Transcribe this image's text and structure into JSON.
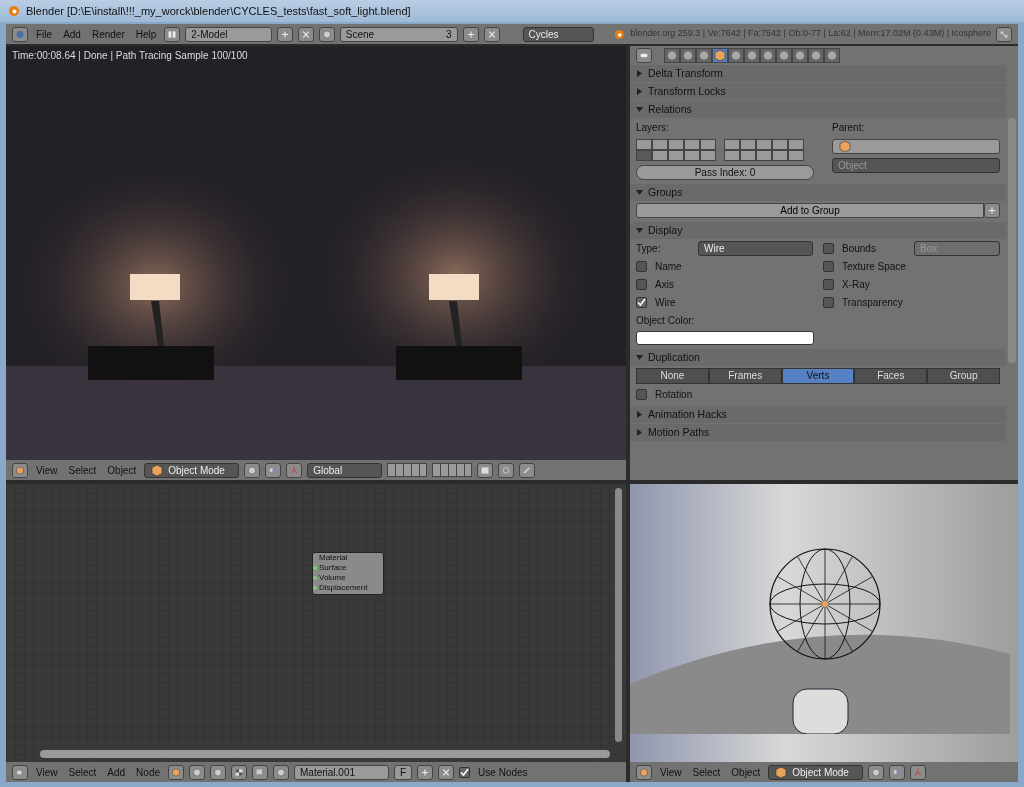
{
  "window": {
    "title": "Blender [D:\\E\\install\\!!!_my_worck\\blender\\CYCLES_tests\\fast_soft_light.blend]"
  },
  "top_header": {
    "menus": [
      "File",
      "Add",
      "Render",
      "Help"
    ],
    "screen_layout": "2-Model",
    "scene": "Scene",
    "scene_users": "3",
    "engine": "Cycles",
    "stats": "blender.org 259.3 | Ve:7642 | Fa:7542 | Ob:0-77 | La:62 | Mem:17.02M (0.43M) | Icosphere"
  },
  "render_view": {
    "status": "Time:00:08.64 | Done | Path Tracing Sample 100/100"
  },
  "view3d_header": {
    "menus": [
      "View",
      "Select",
      "Object"
    ],
    "mode": "Object Mode",
    "orientation": "Global"
  },
  "properties": {
    "tabs": [
      {
        "selected": false
      },
      {
        "selected": false
      },
      {
        "selected": false
      },
      {
        "selected": true
      },
      {
        "selected": false
      },
      {
        "selected": false
      },
      {
        "selected": false
      },
      {
        "selected": false
      },
      {
        "selected": false
      },
      {
        "selected": false
      },
      {
        "selected": false
      }
    ],
    "panels": [
      {
        "kind": "collapsed",
        "title": "Delta Transform"
      },
      {
        "kind": "collapsed",
        "title": "Transform Locks"
      },
      {
        "kind": "relations",
        "title": "Relations",
        "layers_label": "Layers:",
        "layers": [
          false,
          false,
          false,
          false,
          false,
          false,
          false,
          false,
          false,
          false,
          true,
          false,
          false,
          false,
          false,
          false,
          false,
          false,
          false,
          false
        ],
        "parent_label": "Parent:",
        "parent_type_placeholder": "Object",
        "pass_index": "Pass Index: 0"
      },
      {
        "kind": "groups",
        "title": "Groups",
        "add_button": "Add to Group"
      },
      {
        "kind": "display",
        "title": "Display",
        "type_label": "Type:",
        "type_value": "Wire",
        "bounds": {
          "label": "Bounds",
          "checked": false
        },
        "bounds_type": {
          "value": "Box",
          "disabled": true
        },
        "left_checks": [
          {
            "label": "Name",
            "checked": false
          },
          {
            "label": "Axis",
            "checked": false
          },
          {
            "label": "Wire",
            "checked": true
          }
        ],
        "right_checks": [
          {
            "label": "Texture Space",
            "checked": false
          },
          {
            "label": "X-Ray",
            "checked": false
          },
          {
            "label": "Transparency",
            "checked": false
          }
        ],
        "color_label": "Object Color:",
        "color": "#ffffff"
      },
      {
        "kind": "duplication",
        "title": "Duplication",
        "options": [
          {
            "label": "None",
            "selected": false
          },
          {
            "label": "Frames",
            "selected": false
          },
          {
            "label": "Verts",
            "selected": true
          },
          {
            "label": "Faces",
            "selected": false
          },
          {
            "label": "Group",
            "selected": false
          }
        ],
        "rotation": {
          "label": "Rotation",
          "checked": false
        }
      },
      {
        "kind": "collapsed",
        "title": "Animation Hacks"
      },
      {
        "kind": "collapsed",
        "title": "Motion Paths"
      }
    ]
  },
  "node_editor": {
    "node": {
      "title": "Material",
      "sockets": [
        "Surface",
        "Volume",
        "Displacement"
      ]
    },
    "menus": [
      "View",
      "Select",
      "Add",
      "Node"
    ],
    "material": "Material.001",
    "fake_user": "F",
    "use_nodes": {
      "label": "Use Nodes",
      "checked": true
    }
  },
  "view3d_right_header": {
    "menus": [
      "View",
      "Select",
      "Object"
    ],
    "mode": "Object Mode"
  }
}
